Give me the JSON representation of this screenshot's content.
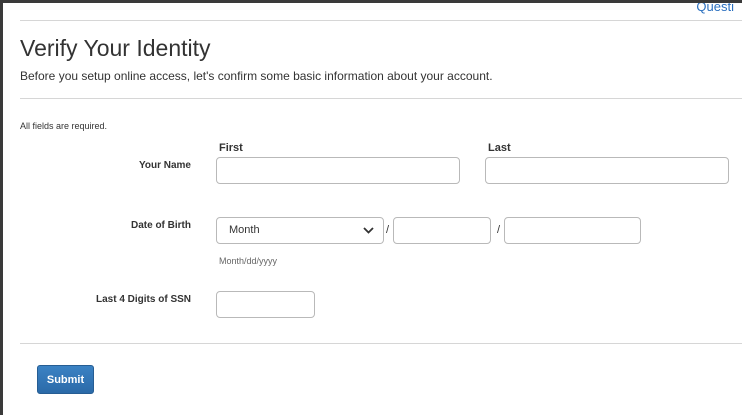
{
  "header": {
    "top_link_label": "Questi"
  },
  "page": {
    "title": "Verify Your Identity",
    "subtitle": "Before you setup online access, let's confirm some basic information about your account.",
    "required_note": "All fields are required."
  },
  "form": {
    "name": {
      "label": "Your Name",
      "first_heading": "First",
      "last_heading": "Last",
      "first_value": "",
      "last_value": ""
    },
    "dob": {
      "label": "Date of Birth",
      "month_value": "Month",
      "separator": "/",
      "day_value": "",
      "year_value": "",
      "hint": "Month/dd/yyyy"
    },
    "ssn": {
      "label": "Last 4 Digits of SSN",
      "value": ""
    },
    "submit_label": "Submit"
  },
  "colors": {
    "accent": "#2f74b5",
    "link": "#2a6fbf",
    "border": "#b9b9b9",
    "divider": "#d6d6d6"
  },
  "icons": {
    "dropdown": "chevron-down-icon"
  }
}
